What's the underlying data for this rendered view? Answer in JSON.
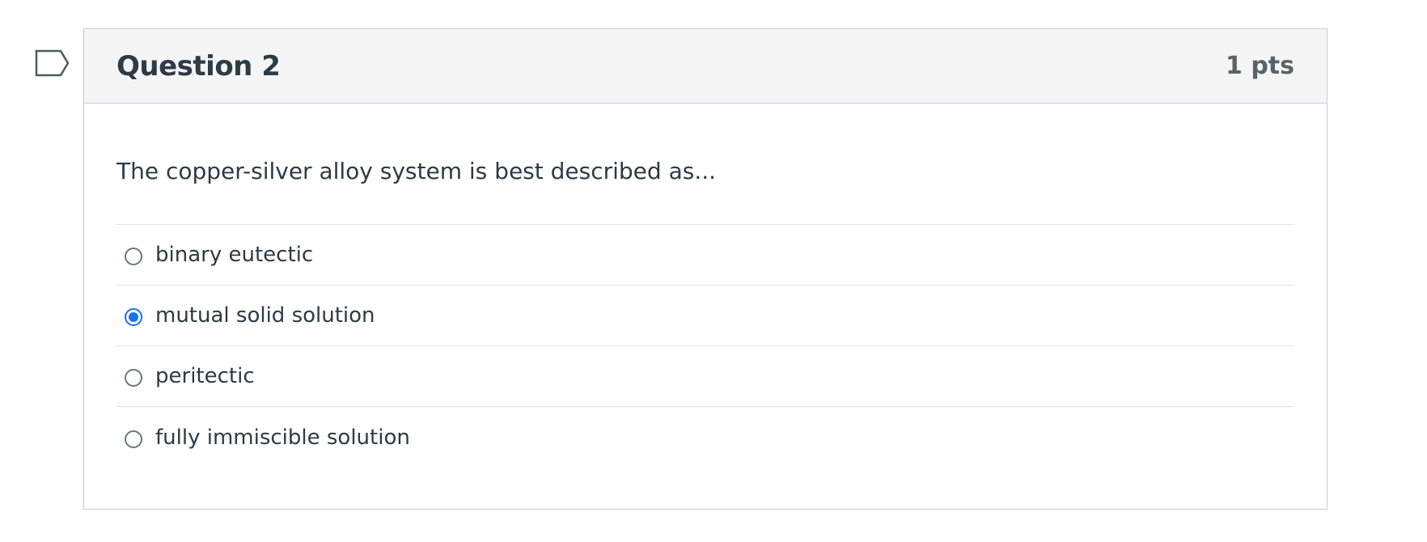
{
  "question": {
    "title": "Question 2",
    "points": "1 pts",
    "text": "The copper-silver alloy system is best described as...",
    "answers": [
      {
        "label": "binary eutectic",
        "selected": false
      },
      {
        "label": "mutual solid solution",
        "selected": true
      },
      {
        "label": "peritectic",
        "selected": false
      },
      {
        "label": "fully immiscible solution",
        "selected": false
      }
    ]
  },
  "icons": {
    "flag": "flag-question-icon",
    "radio_checked": "radio-checked-icon",
    "radio_unchecked": "radio-unchecked-icon"
  },
  "colors": {
    "accent": "#1a73e8",
    "header_bg": "#f5f5f5",
    "text": "#2d3b45",
    "points": "#5b6368",
    "border": "#c7cdd1",
    "divider": "#dfe3e5"
  }
}
